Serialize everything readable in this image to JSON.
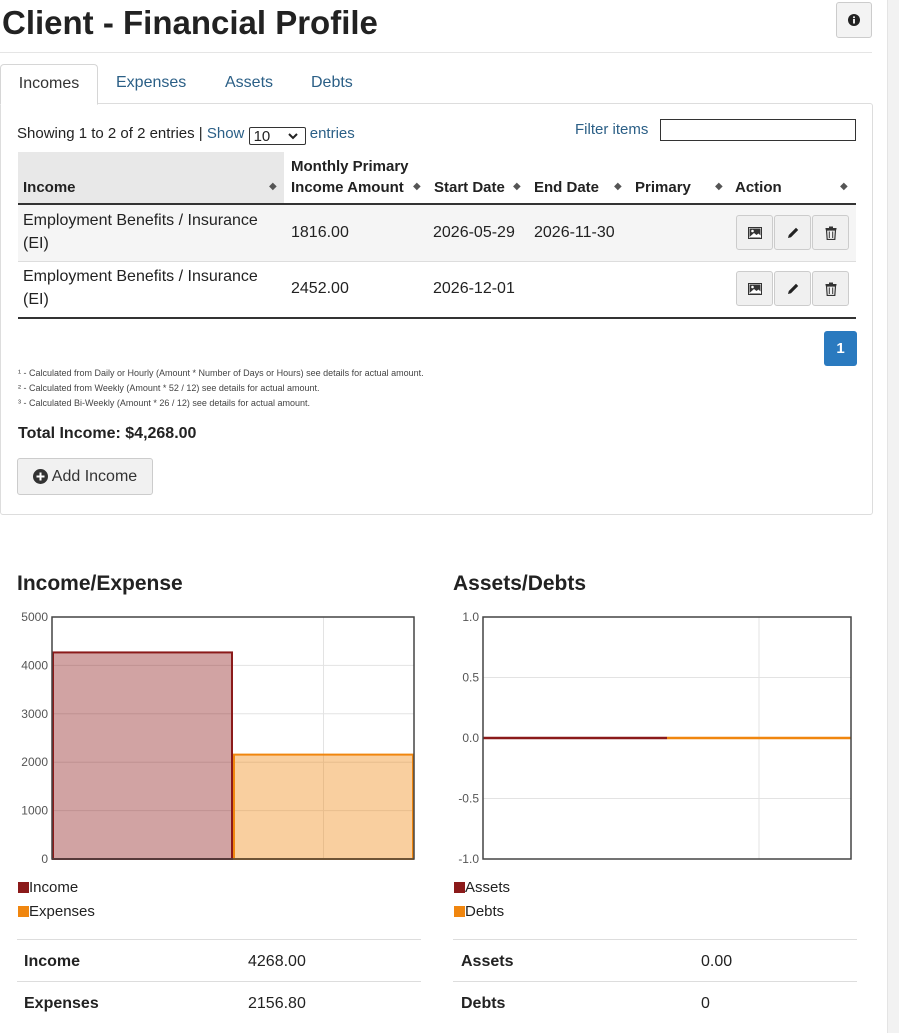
{
  "page": {
    "title": "Client - Financial Profile",
    "info_icon": "info-circle-icon"
  },
  "tabs": [
    {
      "label": "Incomes",
      "active": true
    },
    {
      "label": "Expenses",
      "active": false
    },
    {
      "label": "Assets",
      "active": false
    },
    {
      "label": "Debts",
      "active": false
    }
  ],
  "table_controls": {
    "showing": "Showing 1 to 2 of 2 entries |",
    "show_label": "Show",
    "page_size": "10",
    "entries_label": "entries",
    "filter_label": "Filter items",
    "filter_value": ""
  },
  "columns": {
    "income": "Income",
    "amount_line1": "Monthly Primary",
    "amount_line2": "Income Amount",
    "start": "Start Date",
    "end": "End Date",
    "primary": "Primary",
    "action": "Action"
  },
  "rows": [
    {
      "income_line1": "Employment Benefits / Insurance",
      "income_line2": "(EI)",
      "amount": "1816.00",
      "start": "2026-05-29",
      "end": "2026-11-30",
      "primary": ""
    },
    {
      "income_line1": "Employment Benefits / Insurance",
      "income_line2": "(EI)",
      "amount": "2452.00",
      "start": "2026-12-01",
      "end": "",
      "primary": ""
    }
  ],
  "pagination": {
    "current": "1"
  },
  "notes": [
    "¹ - Calculated from Daily or Hourly (Amount * Number of Days or Hours) see details for actual amount.",
    "² - Calculated from Weekly (Amount * 52 / 12) see details for actual amount.",
    "³ - Calculated Bi-Weekly (Amount * 26 / 12) see details for actual amount."
  ],
  "total_income": "Total Income: $4,268.00",
  "add_button": "Add Income",
  "colors": {
    "primary_blue": "#2a7abf",
    "link": "#2b5f86",
    "income": "#8b1a1a",
    "expenses": "#f0860f"
  },
  "chart_data": [
    {
      "type": "bar",
      "title": "Income/Expense",
      "categories": [
        "Income",
        "Expenses"
      ],
      "series": [
        {
          "name": "Income",
          "values": [
            4268.0,
            null
          ]
        },
        {
          "name": "Expenses",
          "values": [
            null,
            2156.8
          ]
        }
      ],
      "ylim": [
        0,
        5000
      ],
      "yticks": [
        "0",
        "1000",
        "2000",
        "3000",
        "4000",
        "5000"
      ],
      "grid": true,
      "legend": "bottom-left"
    },
    {
      "type": "line",
      "title": "Assets/Debts",
      "series": [
        {
          "name": "Assets",
          "values": [
            0,
            0
          ]
        },
        {
          "name": "Debts",
          "values": [
            0,
            0
          ]
        }
      ],
      "ylim": [
        -1.0,
        1.0
      ],
      "yticks": [
        "-1.0",
        "-0.5",
        "0.0",
        "0.5",
        "1.0"
      ],
      "grid": true,
      "legend": "bottom-left"
    }
  ],
  "summary_income_expense": [
    {
      "label": "Income",
      "value": "4268.00"
    },
    {
      "label": "Expenses",
      "value": "2156.80"
    }
  ],
  "summary_assets_debts": [
    {
      "label": "Assets",
      "value": "0.00"
    },
    {
      "label": "Debts",
      "value": "0"
    }
  ]
}
